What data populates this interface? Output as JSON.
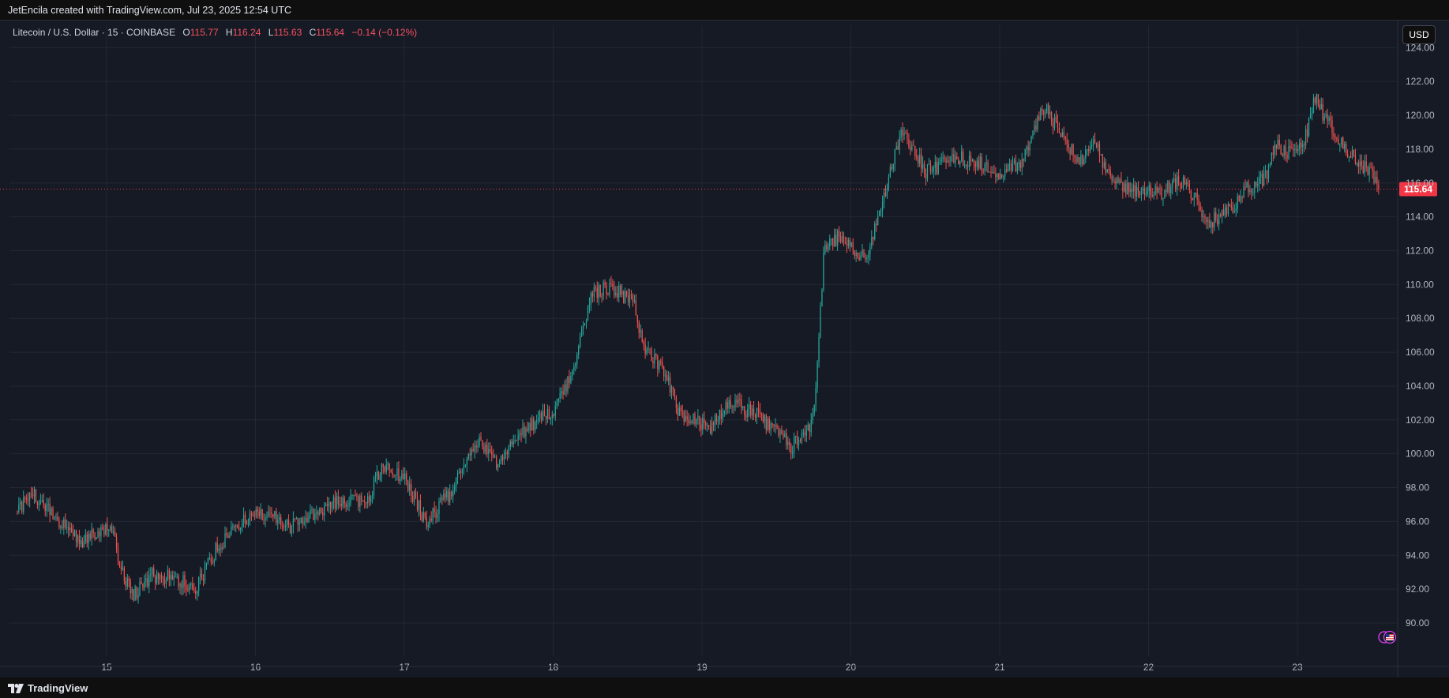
{
  "header": {
    "credit": "JetEncila created with TradingView.com, Jul 23, 2025 12:54 UTC"
  },
  "legend": {
    "symbol": "Litecoin / U.S. Dollar · 15 · COINBASE",
    "o_label": "O",
    "o": "115.77",
    "h_label": "H",
    "h": "116.24",
    "l_label": "L",
    "l": "115.63",
    "c_label": "C",
    "c": "115.64",
    "change": "−0.14 (−0.12%)"
  },
  "toolbar": {
    "currency": "USD"
  },
  "footer": {
    "brand": "TradingView"
  },
  "colors": {
    "background": "#161a25",
    "grid": "#232733",
    "up": "#26a69a",
    "down": "#ef5350",
    "last_price": "#f23645",
    "axis_text": "#b2b5be"
  },
  "icons": {
    "brand_logo": "tradingview-logo-icon",
    "event": "us-flag-event-icon"
  },
  "chart_data": {
    "type": "candlestick",
    "symbol": "LTCUSD",
    "interval": "15",
    "exchange": "COINBASE",
    "ylim": [
      88.6,
      125.6
    ],
    "yticks": [
      "124.00",
      "122.00",
      "120.00",
      "118.00",
      "116.00",
      "114.00",
      "112.00",
      "110.00",
      "108.00",
      "106.00",
      "104.00",
      "102.00",
      "100.00",
      "98.00",
      "96.00",
      "94.00",
      "92.00",
      "90.00"
    ],
    "ytick_values": [
      124,
      122,
      120,
      118,
      116,
      114,
      112,
      110,
      108,
      106,
      104,
      102,
      100,
      98,
      96,
      94,
      92,
      90
    ],
    "xticks": [
      "15",
      "16",
      "17",
      "18",
      "19",
      "20",
      "21",
      "22",
      "23"
    ],
    "xtick_days": [
      15,
      16,
      17,
      18,
      19,
      20,
      21,
      22,
      23
    ],
    "x_start_day": 14.4,
    "x_end_day": 23.55,
    "last_price": 115.64,
    "last_price_label": "115.64",
    "grid": true,
    "anchors": [
      {
        "day": 14.4,
        "price": 96.6
      },
      {
        "day": 14.5,
        "price": 97.6
      },
      {
        "day": 14.6,
        "price": 96.8
      },
      {
        "day": 14.75,
        "price": 95.4
      },
      {
        "day": 14.85,
        "price": 94.8
      },
      {
        "day": 15.02,
        "price": 95.8
      },
      {
        "day": 15.12,
        "price": 92.6
      },
      {
        "day": 15.18,
        "price": 91.6
      },
      {
        "day": 15.3,
        "price": 92.8
      },
      {
        "day": 15.45,
        "price": 92.7
      },
      {
        "day": 15.6,
        "price": 92.0
      },
      {
        "day": 15.75,
        "price": 94.6
      },
      {
        "day": 15.95,
        "price": 96.3
      },
      {
        "day": 16.1,
        "price": 96.4
      },
      {
        "day": 16.2,
        "price": 95.6
      },
      {
        "day": 16.4,
        "price": 96.4
      },
      {
        "day": 16.55,
        "price": 97.3
      },
      {
        "day": 16.75,
        "price": 97.2
      },
      {
        "day": 16.85,
        "price": 99.3
      },
      {
        "day": 17.0,
        "price": 98.6
      },
      {
        "day": 17.15,
        "price": 95.9
      },
      {
        "day": 17.3,
        "price": 97.6
      },
      {
        "day": 17.5,
        "price": 100.8
      },
      {
        "day": 17.6,
        "price": 99.4
      },
      {
        "day": 17.8,
        "price": 101.3
      },
      {
        "day": 18.0,
        "price": 102.6
      },
      {
        "day": 18.15,
        "price": 105.2
      },
      {
        "day": 18.25,
        "price": 109.4
      },
      {
        "day": 18.4,
        "price": 109.9
      },
      {
        "day": 18.55,
        "price": 108.8
      },
      {
        "day": 18.6,
        "price": 106.3
      },
      {
        "day": 18.75,
        "price": 104.8
      },
      {
        "day": 18.85,
        "price": 102.3
      },
      {
        "day": 19.05,
        "price": 101.5
      },
      {
        "day": 19.2,
        "price": 103.0
      },
      {
        "day": 19.4,
        "price": 102.1
      },
      {
        "day": 19.6,
        "price": 100.4
      },
      {
        "day": 19.73,
        "price": 101.6
      },
      {
        "day": 19.77,
        "price": 104.2
      },
      {
        "day": 19.82,
        "price": 112.4
      },
      {
        "day": 19.92,
        "price": 112.8
      },
      {
        "day": 20.1,
        "price": 111.4
      },
      {
        "day": 20.25,
        "price": 116.2
      },
      {
        "day": 20.35,
        "price": 119.2
      },
      {
        "day": 20.5,
        "price": 116.6
      },
      {
        "day": 20.7,
        "price": 117.6
      },
      {
        "day": 20.85,
        "price": 117.2
      },
      {
        "day": 21.0,
        "price": 116.6
      },
      {
        "day": 21.15,
        "price": 117.3
      },
      {
        "day": 21.3,
        "price": 120.6
      },
      {
        "day": 21.45,
        "price": 118.2
      },
      {
        "day": 21.55,
        "price": 117.2
      },
      {
        "day": 21.62,
        "price": 118.6
      },
      {
        "day": 21.75,
        "price": 116.2
      },
      {
        "day": 21.9,
        "price": 115.6
      },
      {
        "day": 22.1,
        "price": 115.4
      },
      {
        "day": 22.2,
        "price": 116.2
      },
      {
        "day": 22.3,
        "price": 115.4
      },
      {
        "day": 22.4,
        "price": 113.6
      },
      {
        "day": 22.55,
        "price": 114.4
      },
      {
        "day": 22.65,
        "price": 115.6
      },
      {
        "day": 22.8,
        "price": 116.4
      },
      {
        "day": 22.85,
        "price": 118.6
      },
      {
        "day": 22.92,
        "price": 117.6
      },
      {
        "day": 23.05,
        "price": 118.6
      },
      {
        "day": 23.12,
        "price": 121.0
      },
      {
        "day": 23.2,
        "price": 119.6
      },
      {
        "day": 23.32,
        "price": 118.2
      },
      {
        "day": 23.42,
        "price": 117.0
      },
      {
        "day": 23.5,
        "price": 116.6
      },
      {
        "day": 23.55,
        "price": 115.64
      }
    ]
  }
}
